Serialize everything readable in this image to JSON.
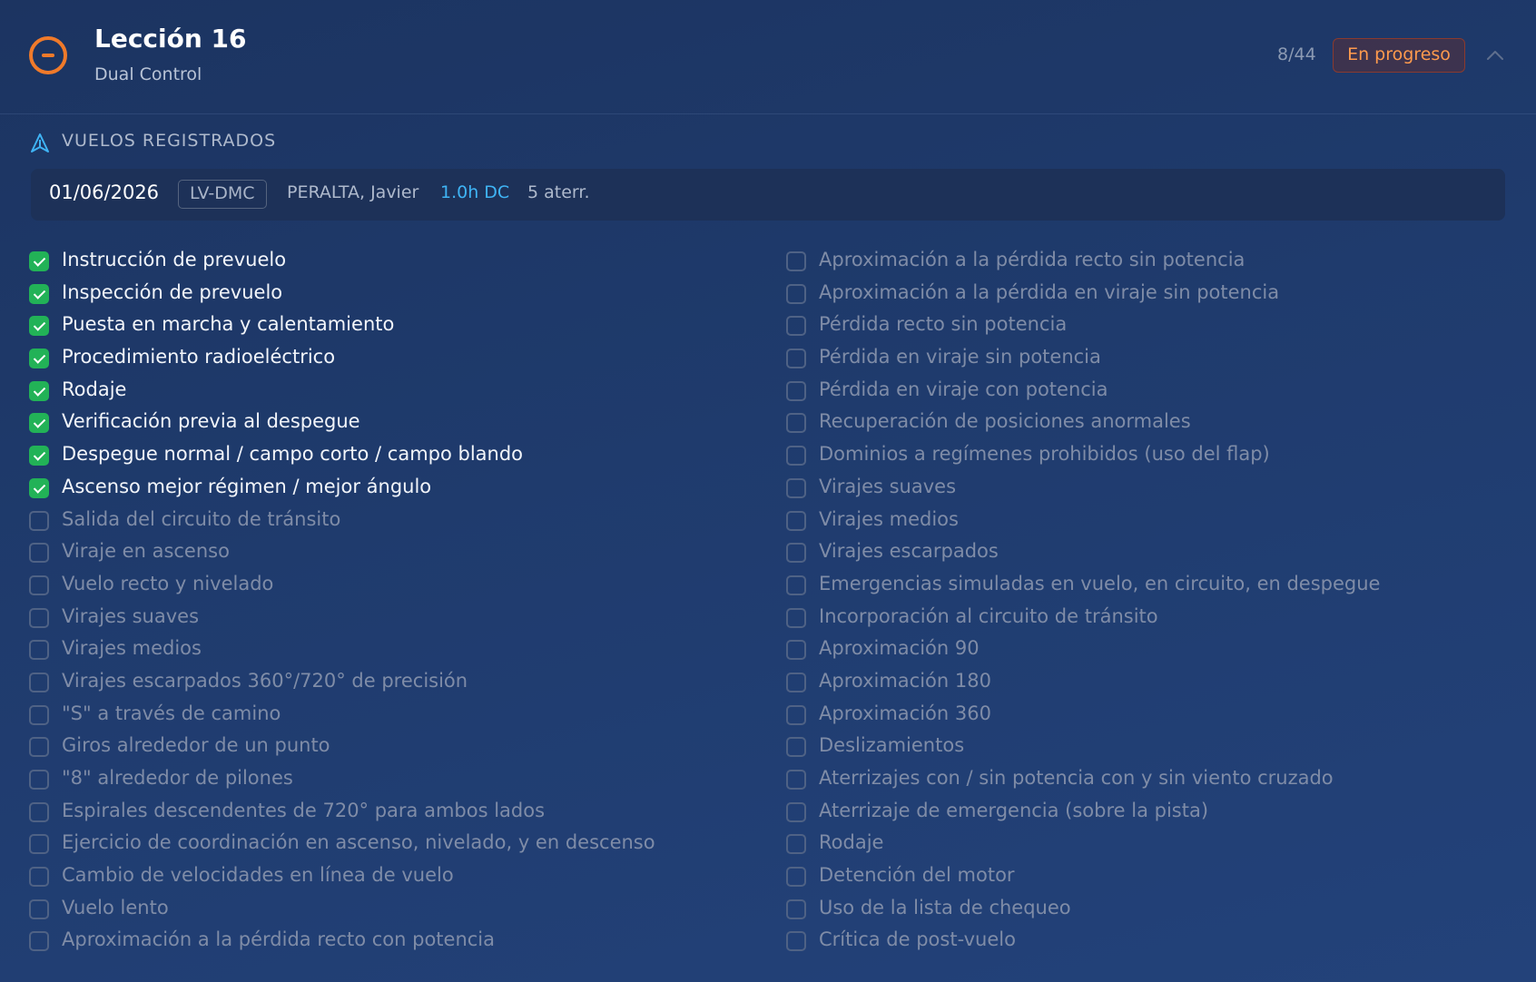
{
  "lesson": {
    "title": "Lección 16",
    "subtitle": "Dual Control",
    "progress": "8/44",
    "status": "En progreso",
    "status_icon": "minus-circle-icon",
    "collapse_icon": "chevron-up-icon"
  },
  "flights_section": {
    "label": "VUELOS REGISTRADOS",
    "icon": "navigation-arrow-icon",
    "flights": [
      {
        "date": "01/06/2026",
        "registration": "LV-DMC",
        "instructor": "PERALTA, Javier",
        "hours": "1.0h DC",
        "landings": "5 aterr."
      }
    ]
  },
  "checklist": {
    "left": [
      {
        "label": "Instrucción de prevuelo",
        "checked": true
      },
      {
        "label": "Inspección de prevuelo",
        "checked": true
      },
      {
        "label": "Puesta en marcha y calentamiento",
        "checked": true
      },
      {
        "label": "Procedimiento radioeléctrico",
        "checked": true
      },
      {
        "label": "Rodaje",
        "checked": true
      },
      {
        "label": "Verificación previa al despegue",
        "checked": true
      },
      {
        "label": "Despegue normal / campo corto / campo blando",
        "checked": true
      },
      {
        "label": "Ascenso mejor régimen / mejor ángulo",
        "checked": true
      },
      {
        "label": "Salida del circuito de tránsito",
        "checked": false
      },
      {
        "label": "Viraje en ascenso",
        "checked": false
      },
      {
        "label": "Vuelo recto y nivelado",
        "checked": false
      },
      {
        "label": "Virajes suaves",
        "checked": false
      },
      {
        "label": "Virajes medios",
        "checked": false
      },
      {
        "label": "Virajes escarpados 360°/720° de precisión",
        "checked": false
      },
      {
        "label": "\"S\" a través de camino",
        "checked": false
      },
      {
        "label": "Giros alrededor de un punto",
        "checked": false
      },
      {
        "label": "\"8\" alrededor de pilones",
        "checked": false
      },
      {
        "label": "Espirales descendentes de 720° para ambos lados",
        "checked": false
      },
      {
        "label": "Ejercicio de coordinación en ascenso, nivelado, y en descenso",
        "checked": false
      },
      {
        "label": "Cambio de velocidades en línea de vuelo",
        "checked": false
      },
      {
        "label": "Vuelo lento",
        "checked": false
      },
      {
        "label": "Aproximación a la pérdida recto con potencia",
        "checked": false
      }
    ],
    "right": [
      {
        "label": "Aproximación a la pérdida recto sin potencia",
        "checked": false
      },
      {
        "label": "Aproximación a la pérdida en viraje sin potencia",
        "checked": false
      },
      {
        "label": "Pérdida recto sin potencia",
        "checked": false
      },
      {
        "label": "Pérdida en viraje sin potencia",
        "checked": false
      },
      {
        "label": "Pérdida en viraje con potencia",
        "checked": false
      },
      {
        "label": "Recuperación de posiciones anormales",
        "checked": false
      },
      {
        "label": "Dominios a regímenes prohibidos (uso del flap)",
        "checked": false
      },
      {
        "label": "Virajes suaves",
        "checked": false
      },
      {
        "label": "Virajes medios",
        "checked": false
      },
      {
        "label": "Virajes escarpados",
        "checked": false
      },
      {
        "label": "Emergencias simuladas en vuelo, en circuito, en despegue",
        "checked": false
      },
      {
        "label": "Incorporación al circuito de tránsito",
        "checked": false
      },
      {
        "label": "Aproximación 90",
        "checked": false
      },
      {
        "label": "Aproximación 180",
        "checked": false
      },
      {
        "label": "Aproximación 360",
        "checked": false
      },
      {
        "label": "Deslizamientos",
        "checked": false
      },
      {
        "label": "Aterrizajes con / sin potencia con y sin viento cruzado",
        "checked": false
      },
      {
        "label": "Aterrizaje de emergencia (sobre la pista)",
        "checked": false
      },
      {
        "label": "Rodaje",
        "checked": false
      },
      {
        "label": "Detención del motor",
        "checked": false
      },
      {
        "label": "Uso de la lista de chequeo",
        "checked": false
      },
      {
        "label": "Crítica de post-vuelo",
        "checked": false
      }
    ]
  },
  "colors": {
    "accent_orange": "#f07a2a",
    "checked_green": "#22b257",
    "hours_blue": "#3fb4f5"
  }
}
